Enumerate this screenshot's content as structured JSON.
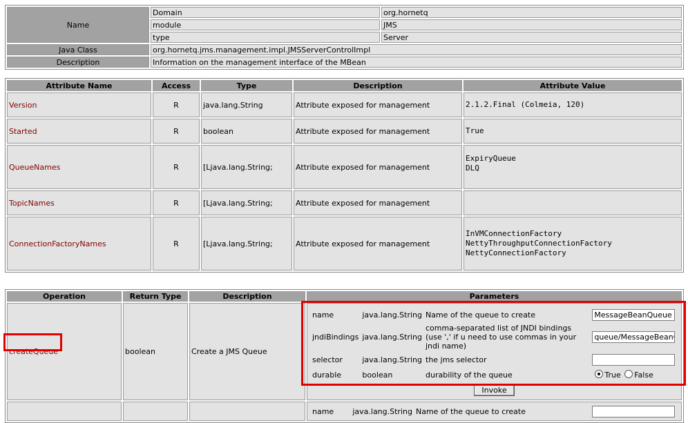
{
  "mbean": {
    "name_label": "Name",
    "name_props": [
      {
        "key": "Domain",
        "value": "org.hornetq"
      },
      {
        "key": "module",
        "value": "JMS"
      },
      {
        "key": "type",
        "value": "Server"
      }
    ],
    "java_class_label": "Java Class",
    "java_class_value": "org.hornetq.jms.management.impl.JMSServerControlImpl",
    "description_label": "Description",
    "description_value": "Information on the management interface of the MBean"
  },
  "attributes": {
    "headers": [
      "Attribute Name",
      "Access",
      "Type",
      "Description",
      "Attribute Value"
    ],
    "rows": [
      {
        "name": "Version",
        "access": "R",
        "type": "java.lang.String",
        "description": "Attribute exposed for management",
        "value": "2.1.2.Final (Colmeia, 120)"
      },
      {
        "name": "Started",
        "access": "R",
        "type": "boolean",
        "description": "Attribute exposed for management",
        "value": "True"
      },
      {
        "name": "QueueNames",
        "access": "R",
        "type": "[Ljava.lang.String;",
        "description": "Attribute exposed for management",
        "value": "ExpiryQueue\nDLQ"
      },
      {
        "name": "TopicNames",
        "access": "R",
        "type": "[Ljava.lang.String;",
        "description": "Attribute exposed for management",
        "value": ""
      },
      {
        "name": "ConnectionFactoryNames",
        "access": "R",
        "type": "[Ljava.lang.String;",
        "description": "Attribute exposed for management",
        "value": "InVMConnectionFactory\nNettyThroughputConnectionFactory\nNettyConnectionFactory"
      }
    ]
  },
  "operations": {
    "headers": [
      "Operation",
      "Return Type",
      "Description",
      "Parameters"
    ],
    "rows": [
      {
        "name": "createQueue",
        "return_type": "boolean",
        "description": "Create a JMS Queue",
        "params": [
          {
            "name": "name",
            "type": "java.lang.String",
            "desc": "Name of the queue to create",
            "value": "MessageBeanQueue"
          },
          {
            "name": "jndiBindings",
            "type": "java.lang.String",
            "desc": "comma-separated list of JNDI bindings (use ',' if u need to use commas in your jndi name)",
            "value": "queue/MessageBeanQueue"
          },
          {
            "name": "selector",
            "type": "java.lang.String",
            "desc": "the jms selector",
            "value": ""
          }
        ],
        "durable": {
          "name": "durable",
          "type": "boolean",
          "desc": "durability of the queue",
          "true_label": "True",
          "false_label": "False",
          "selected": "True"
        },
        "invoke_label": "Invoke"
      },
      {
        "params": [
          {
            "name": "name",
            "type": "java.lang.String",
            "desc": "Name of the queue to create",
            "value": ""
          }
        ]
      }
    ]
  },
  "colors": {
    "header_bg": "#a2a2a2",
    "cell_bg": "#e3e3e3",
    "attr_name": "#800000",
    "highlight": "#e00000"
  }
}
